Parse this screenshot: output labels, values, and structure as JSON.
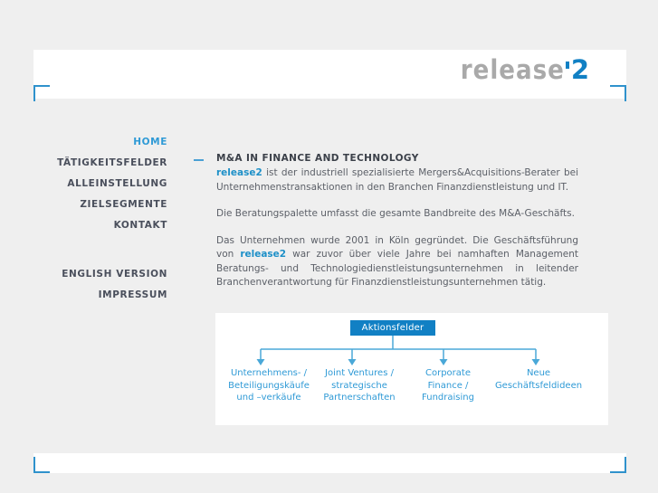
{
  "site": {
    "logo_word": "release",
    "logo_superscript": "2"
  },
  "nav": {
    "items": [
      {
        "label": "HOME",
        "active": true
      },
      {
        "label": "TÄTIGKEITSFELDER",
        "active": false
      },
      {
        "label": "ALLEINSTELLUNG",
        "active": false
      },
      {
        "label": "ZIELSEGMENTE",
        "active": false
      },
      {
        "label": "KONTAKT",
        "active": false
      }
    ],
    "secondary": [
      {
        "label": "ENGLISH VERSION"
      },
      {
        "label": "IMPRESSUM"
      }
    ]
  },
  "main": {
    "title": "M&A IN FINANCE AND TECHNOLOGY",
    "paragraph1_link": "release2",
    "paragraph1_rest": " ist der industriell spezialisierte Mergers&Acquisitions-Berater bei Unternehmenstransaktionen in den Branchen Finanzdienstleistung und IT.",
    "paragraph2": "Die Beratungspalette umfasst die gesamte Bandbreite des M&A-Geschäfts.",
    "paragraph3_pre": "Das Unternehmen wurde 2001 in Köln gegründet. Die Geschäftsführung von ",
    "paragraph3_link": "release2",
    "paragraph3_rest": " war zuvor über viele Jahre bei namhaften Management Beratungs- und Technologiedienstleistungsunternehmen in leitender Branchenverantwortung für Finanzdienstleistungsunternehmen tätig."
  },
  "diagram": {
    "root_label": "Aktionsfelder",
    "leaves": [
      {
        "line1": "Unternehmens- /",
        "line2": "Beteiligungskäufe",
        "line3": "und –verkäufe"
      },
      {
        "line1": "Joint Ventures /",
        "line2": "strategische",
        "line3": "Partnerschaften"
      },
      {
        "line1": "Corporate",
        "line2": "Finance /",
        "line3": "Fundraising"
      },
      {
        "line1": "Neue",
        "line2": "Geschäftsfeldideen",
        "line3": ""
      }
    ]
  },
  "colors": {
    "accent_blue": "#1180c4",
    "link_blue": "#2f9ad6",
    "logo_gray": "#a9a9a9",
    "page_bg": "#efefef"
  }
}
